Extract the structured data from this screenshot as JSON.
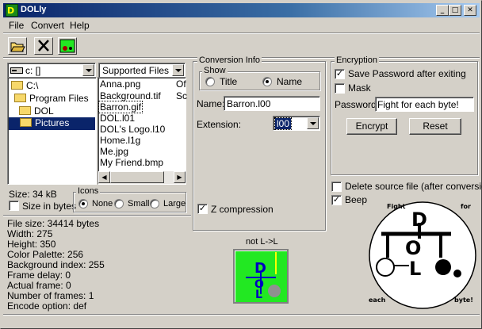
{
  "window": {
    "title": "DOLly",
    "min": "_",
    "max": "□",
    "close": "✕"
  },
  "menu": [
    "File",
    "Convert",
    "Help"
  ],
  "drive": {
    "value": "c: []"
  },
  "filter": {
    "value": "Supported Files"
  },
  "tree": [
    {
      "label": "C:\\",
      "selected": false
    },
    {
      "label": "Program Files",
      "selected": false
    },
    {
      "label": "DOL",
      "selected": false
    },
    {
      "label": "Pictures",
      "selected": true
    }
  ],
  "files": {
    "col1": [
      "Anna.png",
      "Background.tif",
      "Barron.gif",
      "DOL.l01",
      "DOL's Logo.l10",
      "Home.l1g",
      "Me.jpg",
      "My Friend.bmp"
    ],
    "col2": [
      "Of",
      "Sc"
    ],
    "selected_index": 2
  },
  "size_label": "Size: 34 kB",
  "size_in_bytes": {
    "label": "Size in bytes",
    "checked": false
  },
  "icons": {
    "label": "Icons",
    "options": [
      "None",
      "Small",
      "Large"
    ],
    "selected": "None"
  },
  "file_info": [
    "File size: 34414 bytes",
    "Width: 275",
    "Height: 350",
    "Color Palette: 256",
    "Background index: 255",
    "Frame delay: 0",
    "Actual frame: 0",
    "Number of frames: 1",
    "Encode option: def"
  ],
  "conversion": {
    "label": "Conversion Info",
    "show_label": "Show",
    "show_options": [
      "Title",
      "Name"
    ],
    "show_selected": "Name",
    "name_label": "Name:",
    "name_value": "Barron.l00",
    "extension_label": "Extension:",
    "extension_value": "l00",
    "z_compression": {
      "label": "Z compression",
      "checked": true
    }
  },
  "preview": {
    "caption": "not L->L"
  },
  "encryption": {
    "label": "Encryption",
    "save_password": {
      "label": "Save Password after exiting",
      "checked": true
    },
    "mask": {
      "label": "Mask",
      "checked": false
    },
    "password_label": "Password:",
    "password_value": "Fight for each byte!",
    "encrypt_button": "Encrypt",
    "reset_button": "Reset"
  },
  "delete_source": {
    "label": "Delete source file (after conversion)",
    "checked": false
  },
  "beep": {
    "label": "Beep",
    "checked": true
  },
  "logo": {
    "words": [
      "Fight",
      "for",
      "each",
      "byte!"
    ],
    "letters": [
      "D",
      "O",
      "L"
    ]
  },
  "colors": {
    "titlebar": "#0a246a",
    "preview_bg": "#22e822",
    "selection": "#0a246a"
  }
}
